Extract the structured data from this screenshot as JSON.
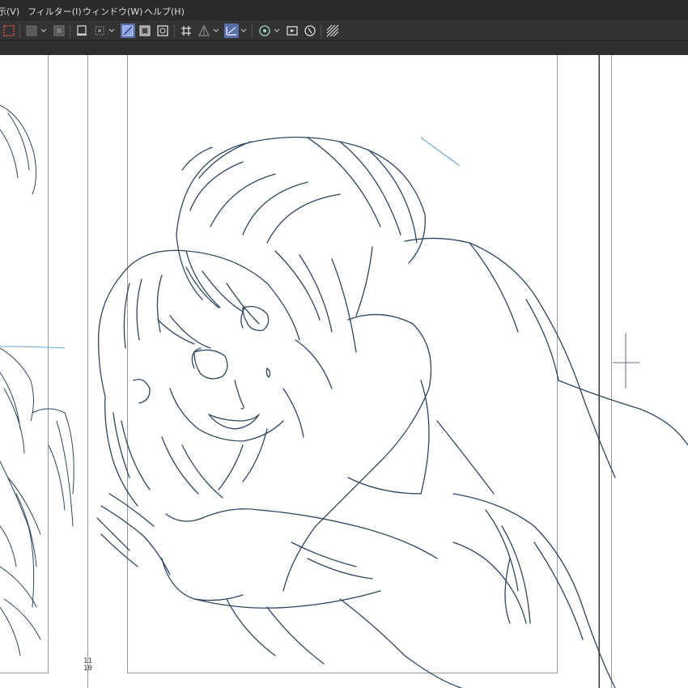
{
  "menubar": {
    "items": [
      {
        "label": "表示(V)"
      },
      {
        "label": "フィルター(I)"
      },
      {
        "label": "ウィンドウ(W)"
      },
      {
        "label": "ヘルプ(H)"
      }
    ]
  },
  "toolbar": {
    "icons": [
      "selection-marquee-icon",
      "fill-layer-icon",
      "layer-mask-icon",
      "canvas-icon",
      "transform-icon",
      "perspective-ruler-icon",
      "layer-color-icon",
      "reference-layer-icon",
      "grid-icon",
      "symmetry-ruler-icon",
      "snap-ruler-icon",
      "3d-icon",
      "animation-icon",
      "navigator-icon",
      "pattern-icon"
    ]
  },
  "canvas": {
    "page_number": "11\n10",
    "sketch_line_color": "#2f4560",
    "accent_line_color": "#6fa7d8"
  }
}
